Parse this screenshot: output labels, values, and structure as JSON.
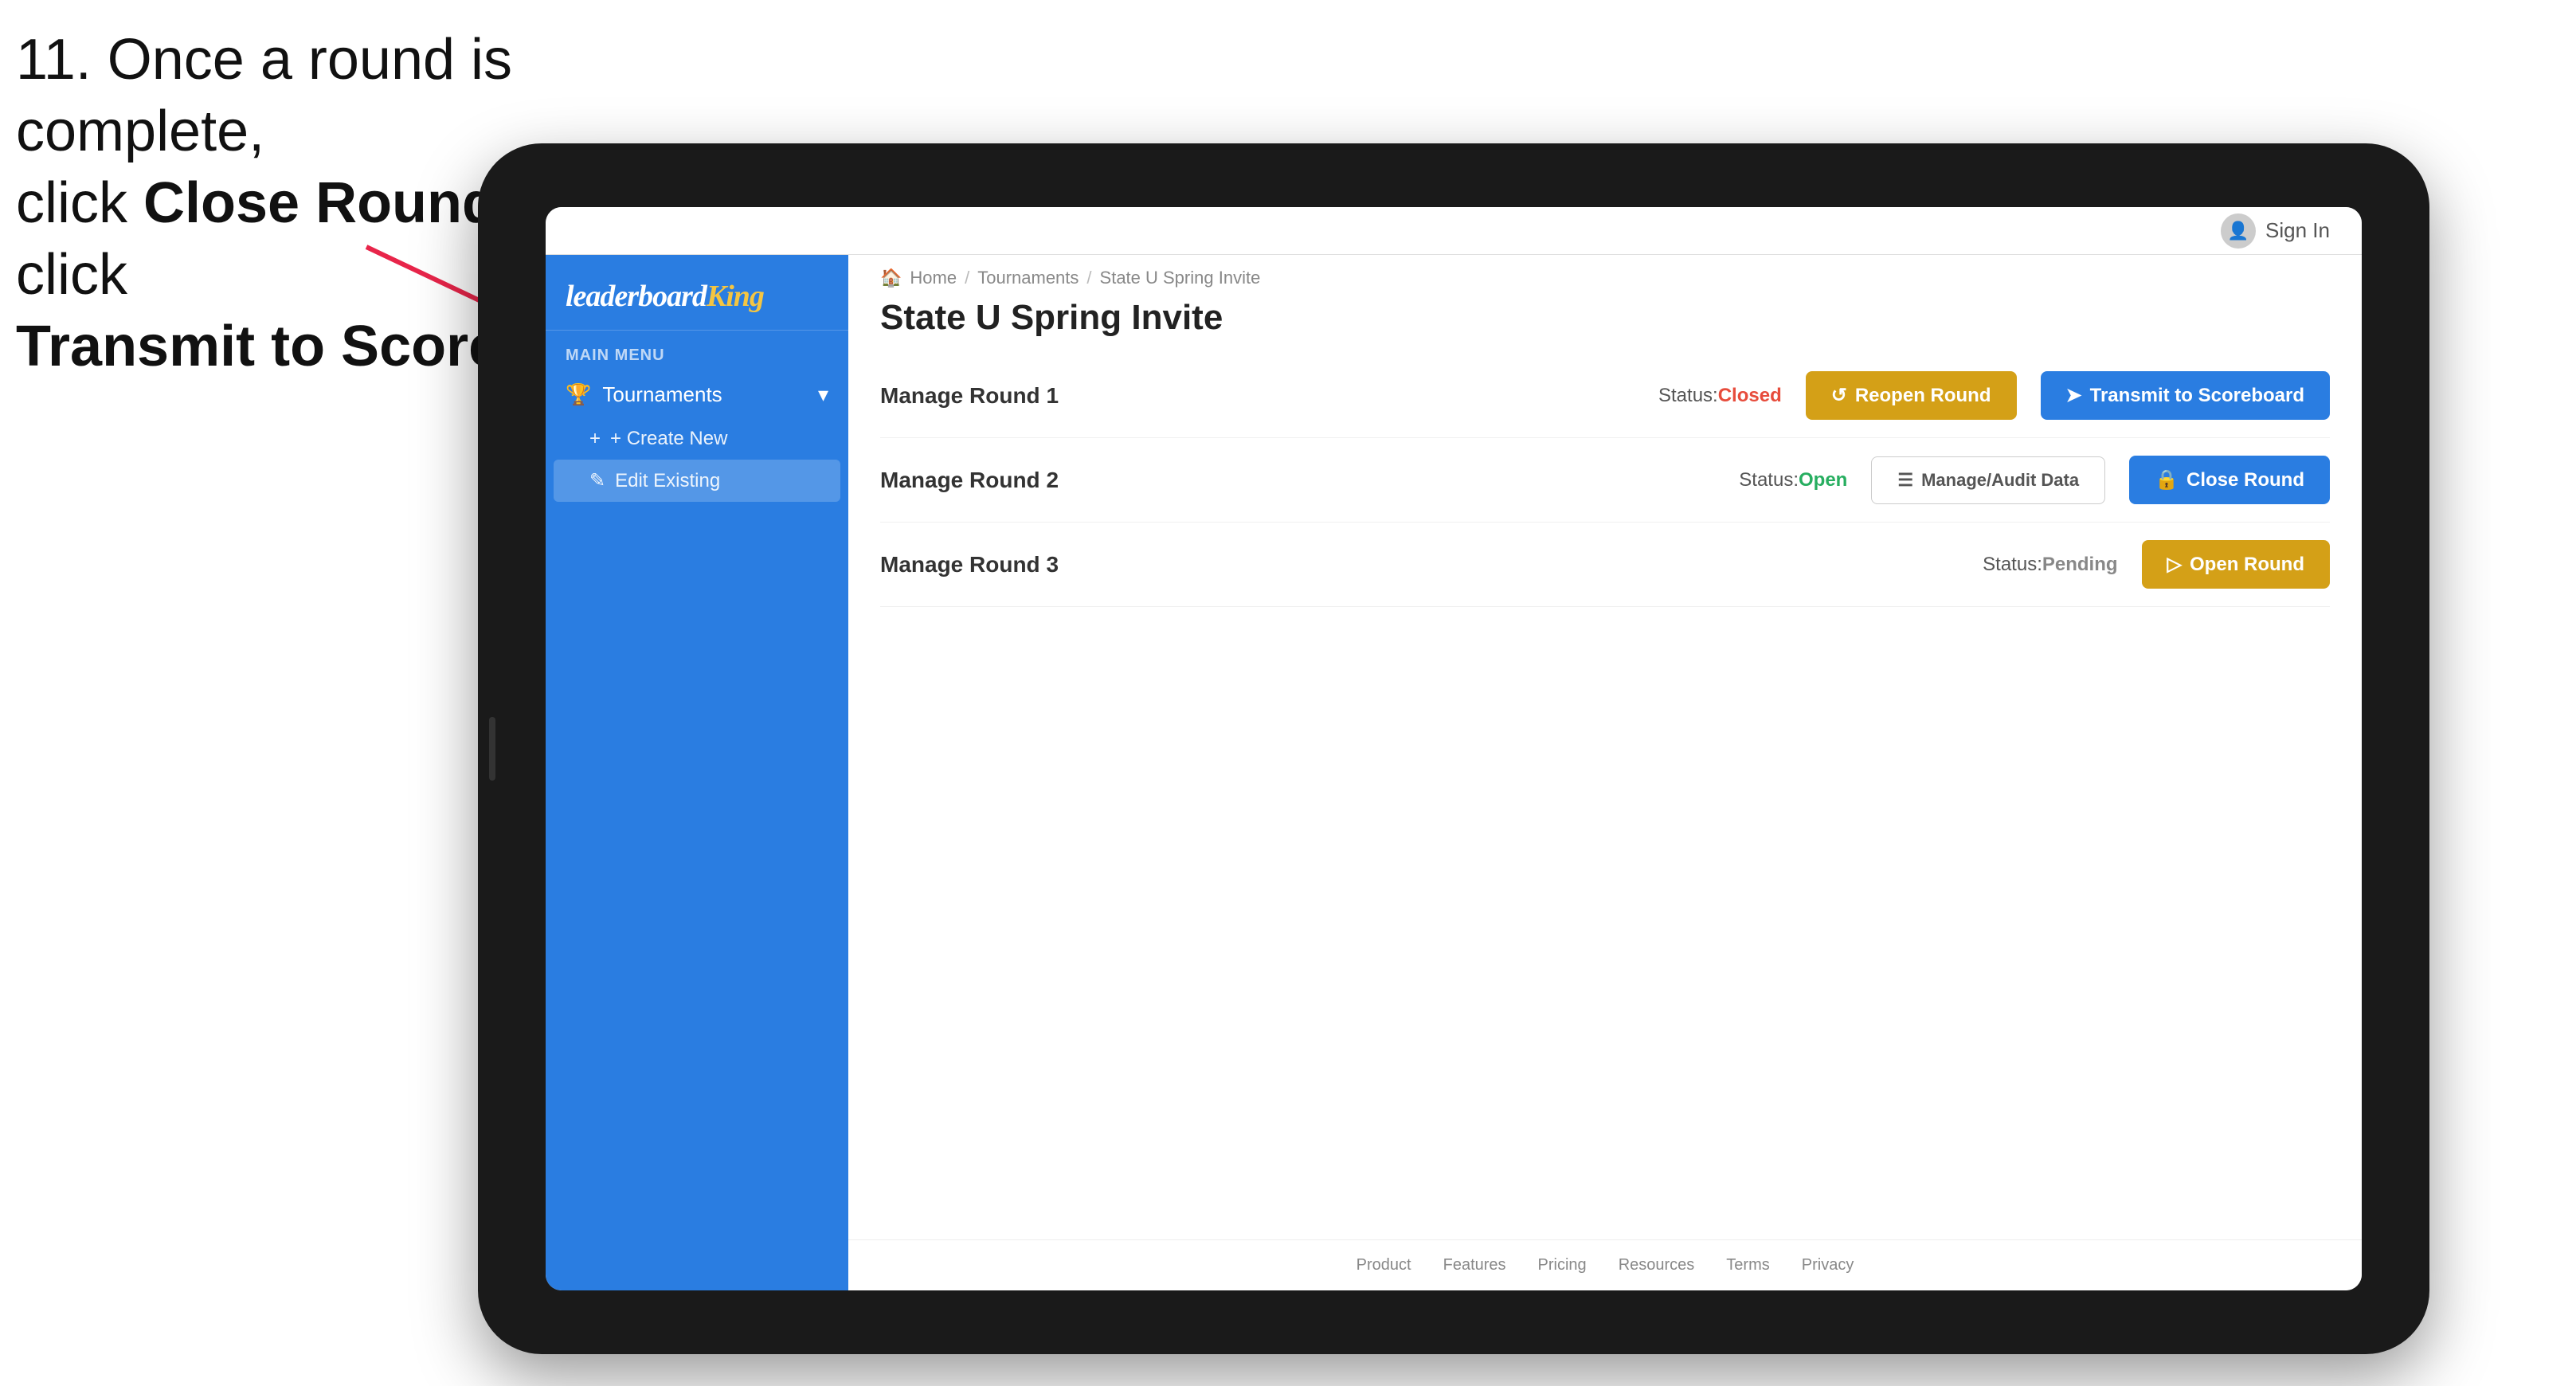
{
  "instruction": {
    "line1": "11. Once a round is complete,",
    "line2": "click ",
    "bold1": "Close Round",
    "line3": " then click",
    "bold2": "Transmit to Scoreboard."
  },
  "topBar": {
    "signIn": "Sign In"
  },
  "logo": {
    "leaderboard": "leaderboard",
    "king": "King"
  },
  "sidebar": {
    "mainMenuLabel": "MAIN MENU",
    "tournamentsLabel": "Tournaments",
    "createNewLabel": "+ Create New",
    "editExistingLabel": "Edit Existing"
  },
  "breadcrumb": {
    "home": "Home",
    "tournaments": "Tournaments",
    "current": "State U Spring Invite"
  },
  "pageTitle": "State U Spring Invite",
  "rounds": [
    {
      "label": "Manage Round 1",
      "status": "Status:",
      "statusValue": "Closed",
      "statusClass": "status-closed",
      "primaryBtnLabel": "Reopen Round",
      "secondaryBtnLabel": "Transmit to Scoreboard",
      "primaryBtnClass": "btn-gold",
      "secondaryBtnClass": "btn-blue",
      "showManage": false
    },
    {
      "label": "Manage Round 2",
      "status": "Status:",
      "statusValue": "Open",
      "statusClass": "status-open",
      "primaryBtnLabel": "Manage/Audit Data",
      "secondaryBtnLabel": "Close Round",
      "primaryBtnClass": "btn-manage",
      "secondaryBtnClass": "btn-blue",
      "showManage": true
    },
    {
      "label": "Manage Round 3",
      "status": "Status:",
      "statusValue": "Pending",
      "statusClass": "status-pending",
      "primaryBtnLabel": "Open Round",
      "secondaryBtnLabel": null,
      "primaryBtnClass": "btn-gold",
      "secondaryBtnClass": null,
      "showManage": false
    }
  ],
  "footer": {
    "links": [
      "Product",
      "Features",
      "Pricing",
      "Resources",
      "Terms",
      "Privacy"
    ]
  }
}
